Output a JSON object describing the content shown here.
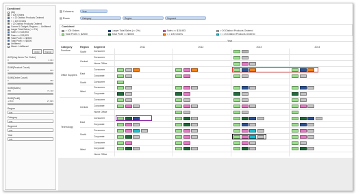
{
  "left_panel": {
    "title": "Combined",
    "checks": [
      {
        "label": "(All)",
        "on": false
      },
      {
        "label": "> 100 Orders",
        "on": true
      },
      {
        "label": "< = 20 Distinct Products Ordered",
        "on": true
      },
      {
        "label": "< = 100 Orders",
        "on": true
      },
      {
        "label": "> 20 Distinct Products Ordered",
        "on": true
      },
      {
        "label": "Corner & Gadget; Regions — Unfiltered",
        "on": true
      },
      {
        "label": "Larger Total Sales (>= 2%)",
        "on": true
      },
      {
        "label": "Sales <= $15,953",
        "on": true
      },
      {
        "label": "Sales >= $15,953",
        "on": true
      },
      {
        "label": "Total Profit <= $2500",
        "on": true
      },
      {
        "label": "Total Profit >= $5000",
        "on": true
      },
      {
        "label": "Unfiltered",
        "on": true
      },
      {
        "label": "Weak - Unfiltered",
        "on": false
      }
    ],
    "apply_label": "Apply",
    "cancel_label": "Cancel",
    "sliders": [
      {
        "label": "AVG(Avg Items Per Order)",
        "min": "0",
        "max": "2.314",
        "lo": 0,
        "hi": 1
      },
      {
        "label": "SUM(Product Count)",
        "min": "0",
        "max": "304",
        "lo": 0,
        "hi": 1
      },
      {
        "label": "SUM(Order Count)",
        "min": "0",
        "max": "469",
        "lo": 0,
        "hi": 1
      },
      {
        "label": "SUM(Sales)",
        "min": "356",
        "max": "71,118",
        "lo": 0,
        "hi": 1
      },
      {
        "label": "SUM(Profit)",
        "min": "-2,800",
        "max": "27,939",
        "lo": 0,
        "hi": 1
      }
    ],
    "dropdowns": [
      {
        "label": "Region",
        "value": "(All)"
      },
      {
        "label": "Category",
        "value": "(All)"
      },
      {
        "label": "Segment",
        "value": "(All)"
      },
      {
        "label": "Year",
        "value": "(All)"
      }
    ]
  },
  "shelves": {
    "columns_label": "Columns",
    "columns_pills": [
      "Year"
    ],
    "rows_label": "Rows",
    "rows_pills": [
      "Category",
      "Region",
      "Segment"
    ]
  },
  "legend": {
    "title": "Combined",
    "items": [
      {
        "label": "> 100 Orders",
        "color": "#b8b8b8"
      },
      {
        "label": "Larger Total Sales (>= 2%)",
        "color": "#2a5298"
      },
      {
        "label": "Sales >= $15,953",
        "color": "#e377c2"
      },
      {
        "label": "> 20 Distinct Products Ordered",
        "color": "#c2c2c2"
      },
      {
        "label": "Total Profit >= $2500",
        "color": "#98df8a"
      },
      {
        "label": "Total Profit >= $5000",
        "color": "#1e6b3a"
      },
      {
        "label": "< = 100 Orders",
        "color": "#ff7f0e"
      },
      {
        "label": "< = 20 Distinct Products Ordered",
        "color": "#17becf"
      }
    ]
  },
  "table": {
    "col_headers": {
      "category": "Category",
      "region": "Region",
      "segment": "Segment"
    },
    "year_title": "Year",
    "years": [
      "2011",
      "2012",
      "2013",
      "2014"
    ],
    "categories": [
      {
        "name": "Furniture",
        "regions": [
          {
            "name": "South",
            "segments": [
              "Consumer"
            ]
          }
        ]
      },
      {
        "name": "Office Supplies",
        "regions": [
          {
            "name": "Central",
            "segments": [
              "Consumer",
              "Home Office"
            ]
          },
          {
            "name": "East",
            "segments": [
              "Consumer",
              "Corporate"
            ]
          },
          {
            "name": "South",
            "segments": [
              "Consumer"
            ]
          },
          {
            "name": "West",
            "segments": [
              "Consumer",
              "Corporate"
            ]
          }
        ]
      },
      {
        "name": "Technology",
        "regions": [
          {
            "name": "Central",
            "segments": [
              "Consumer",
              "Corporate",
              "Home Office"
            ]
          },
          {
            "name": "East",
            "segments": [
              "Consumer",
              "Corporate"
            ]
          },
          {
            "name": "South",
            "segments": [
              "Consumer",
              "Corporate"
            ]
          },
          {
            "name": "West",
            "segments": [
              "Consumer",
              "Corporate",
              "Home Office"
            ]
          }
        ]
      }
    ],
    "cells": [
      [
        [],
        [],
        [
          "#98df8a",
          "#b8b8b8"
        ],
        []
      ],
      [
        [],
        [],
        [
          "#98df8a",
          "#c2c2c2"
        ],
        []
      ],
      [
        [],
        [],
        [
          "#98df8a",
          "#e377c2",
          "#c2c2c2"
        ],
        []
      ],
      [
        [
          "#98df8a",
          "#c2c2c2",
          "#ff7f0e"
        ],
        [
          "#98df8a",
          "#e377c2",
          "#ff7f0e"
        ],
        [
          "#98df8a",
          "#2a5298",
          "#ff7f0e"
        ],
        [
          "#98df8a",
          "#2a5298",
          "#ff7f0e"
        ]
      ],
      [
        [
          "#98df8a",
          "#c2c2c2"
        ],
        [
          "#98df8a",
          "#e377c2"
        ],
        [
          "#98df8a",
          "#c2c2c2"
        ],
        [
          "#98df8a",
          "#c2c2c2"
        ]
      ],
      [
        [
          "#98df8a"
        ],
        [],
        [],
        []
      ],
      [
        [
          "#98df8a",
          "#c2c2c2"
        ],
        [
          "#98df8a",
          "#e377c2",
          "#c2c2c2"
        ],
        [
          "#98df8a",
          "#2a5298",
          "#c2c2c2"
        ],
        [
          "#98df8a",
          "#2a5298",
          "#c2c2c2"
        ]
      ],
      [
        [
          "#1e6b3a",
          "#c2c2c2"
        ],
        [
          "#1e6b3a",
          "#e377c2"
        ],
        [
          "#1e6b3a",
          "#c2c2c2"
        ],
        [
          "#1e6b3a",
          "#c2c2c2"
        ]
      ],
      [
        [
          "#98df8a",
          "#c2c2c2"
        ],
        [
          "#98df8a",
          "#c2c2c2"
        ],
        [
          "#98df8a",
          "#c2c2c2"
        ],
        [
          "#98df8a",
          "#c2c2c2"
        ]
      ],
      [
        [
          "#98df8a",
          "#e377c2",
          "#c2c2c2"
        ],
        [
          "#98df8a",
          "#e377c2",
          "#c2c2c2"
        ],
        [
          "#98df8a",
          "#e377c2",
          "#c2c2c2"
        ],
        [
          "#98df8a",
          "#e377c2",
          "#c2c2c2"
        ]
      ],
      [
        [],
        [
          "#98df8a",
          "#c2c2c2"
        ],
        [
          "#98df8a",
          "#c2c2c2"
        ],
        [
          "#98df8a"
        ]
      ],
      [
        [
          "#98df8a",
          "#1e6b3a",
          "#2a5298"
        ],
        [
          "#98df8a",
          "#1e6b3a",
          "#c2c2c2"
        ],
        [
          "#98df8a",
          "#1e6b3a",
          "#2a5298",
          "#c2c2c2"
        ],
        [
          "#98df8a",
          "#1e6b3a",
          "#2a5298",
          "#c2c2c2"
        ]
      ],
      [
        [
          "#98df8a",
          "#e377c2",
          "#c2c2c2"
        ],
        [
          "#98df8a",
          "#1e6b3a",
          "#c2c2c2"
        ],
        [
          "#98df8a",
          "#2a5298",
          "#c2c2c2"
        ],
        [
          "#98df8a",
          "#2a5298",
          "#c2c2c2"
        ]
      ],
      [
        [
          "#98df8a",
          "#e377c2",
          "#17becf",
          "#c2c2c2"
        ],
        [
          "#98df8a",
          "#e377c2",
          "#c2c2c2"
        ],
        [
          "#98df8a",
          "#e377c2",
          "#17becf",
          "#c2c2c2"
        ],
        [
          "#98df8a",
          "#e377c2",
          "#c2c2c2"
        ]
      ],
      [
        [
          "#98df8a",
          "#1e6b3a",
          "#c2c2c2"
        ],
        [
          "#98df8a",
          "#e377c2",
          "#c2c2c2"
        ],
        [
          "#98df8a",
          "#e377c2",
          "#17becf",
          "#c2c2c2"
        ],
        [
          "#98df8a",
          "#e377c2",
          "#c2c2c2"
        ]
      ],
      [
        [
          "#98df8a",
          "#e377c2"
        ],
        [
          "#98df8a",
          "#e377c2"
        ],
        [
          "#98df8a",
          "#e377c2",
          "#c2c2c2"
        ],
        [
          "#98df8a",
          "#c2c2c2"
        ]
      ],
      [
        [
          "#98df8a",
          "#1e6b3a",
          "#c2c2c2"
        ],
        [
          "#98df8a",
          "#1e6b3a",
          "#c2c2c2"
        ],
        [
          "#98df8a",
          "#1e6b3a",
          "#c2c2c2"
        ],
        [
          "#98df8a",
          "#1e6b3a",
          "#c2c2c2"
        ]
      ]
    ]
  }
}
